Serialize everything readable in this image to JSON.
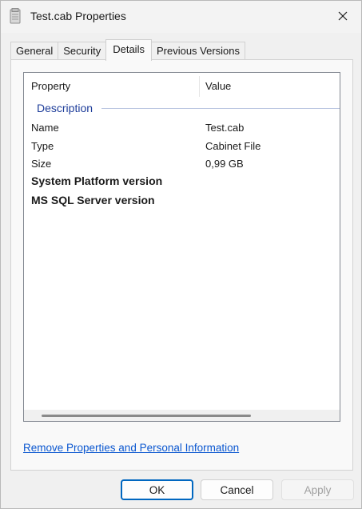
{
  "window": {
    "title": "Test.cab Properties",
    "icon": "cabinet-file-icon"
  },
  "tabs": [
    {
      "label": "General",
      "active": false
    },
    {
      "label": "Security",
      "active": false
    },
    {
      "label": "Details",
      "active": true
    },
    {
      "label": "Previous Versions",
      "active": false
    }
  ],
  "details": {
    "columns": {
      "property": "Property",
      "value": "Value"
    },
    "group_label": "Description",
    "rows": [
      {
        "property": "Name",
        "value": "Test.cab"
      },
      {
        "property": "Type",
        "value": "Cabinet File"
      },
      {
        "property": "Size",
        "value": "0,99 GB"
      },
      {
        "property": "System Platform version",
        "value": ""
      },
      {
        "property": "MS SQL Server version",
        "value": ""
      }
    ]
  },
  "link": {
    "label": "Remove Properties and Personal Information"
  },
  "buttons": {
    "ok": "OK",
    "cancel": "Cancel",
    "apply": "Apply"
  }
}
